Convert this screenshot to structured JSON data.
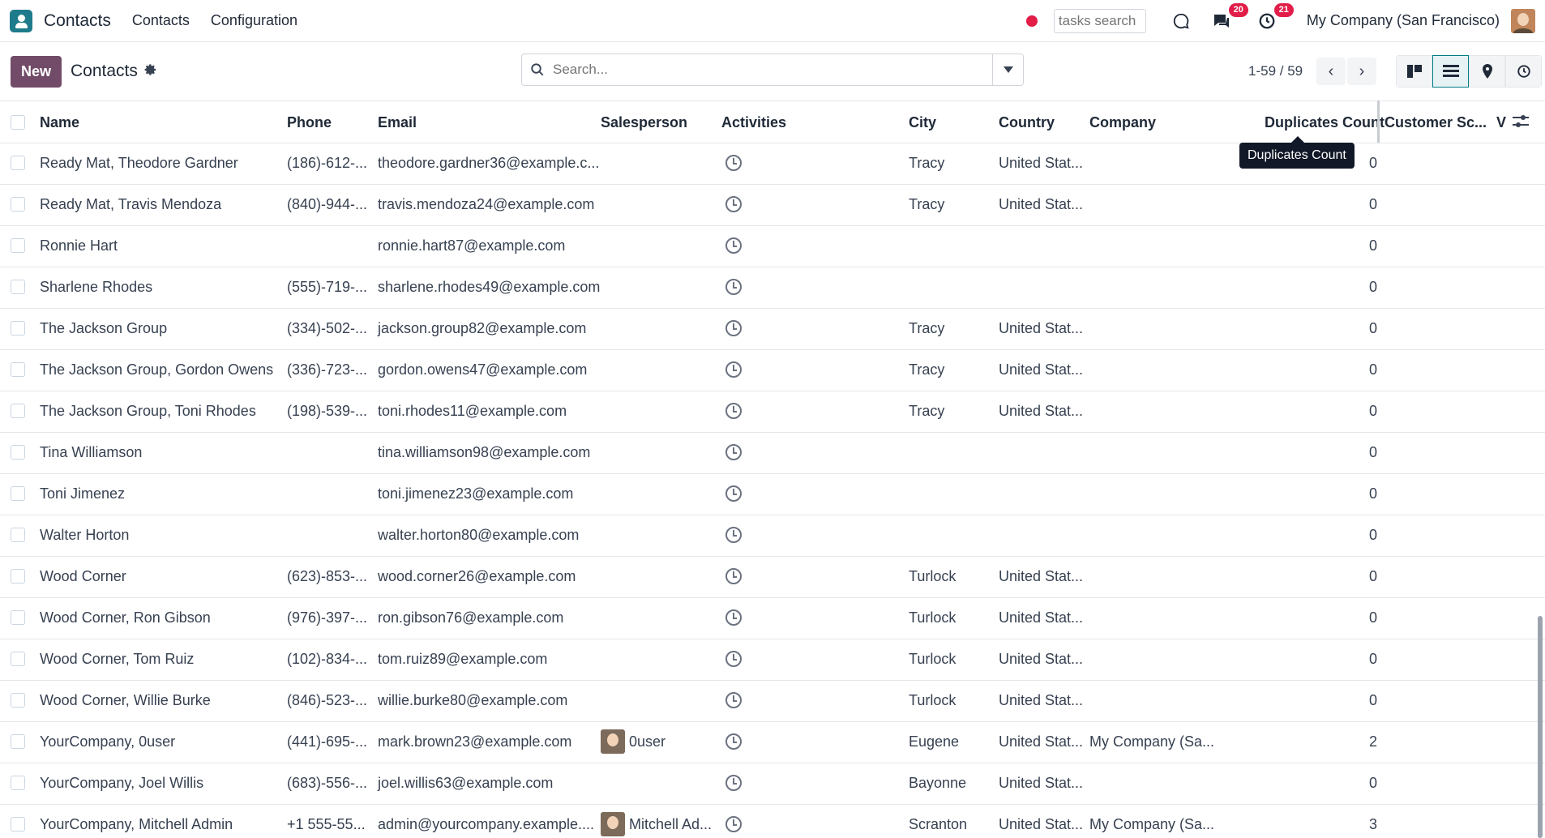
{
  "navbar": {
    "app_name": "Contacts",
    "menu": [
      "Contacts",
      "Configuration"
    ],
    "tasks_search_placeholder": "tasks search",
    "messages_badge": "20",
    "activities_badge": "21",
    "company": "My Company (San Francisco)"
  },
  "control": {
    "new_label": "New",
    "breadcrumb": "Contacts",
    "search_placeholder": "Search...",
    "pager": "1-59 / 59"
  },
  "columns": {
    "name": "Name",
    "phone": "Phone",
    "email": "Email",
    "salesperson": "Salesperson",
    "activities": "Activities",
    "city": "City",
    "country": "Country",
    "company": "Company",
    "duplicates": "Duplicates Count",
    "customer_score": "Customer Sc...",
    "more": "V"
  },
  "tooltip": "Duplicates Count",
  "rows": [
    {
      "name": "Ready Mat, Theodore Gardner",
      "phone": "(186)-612-...",
      "email": "theodore.gardner36@example.c...",
      "salesperson": "",
      "city": "Tracy",
      "country": "United Stat...",
      "company": "",
      "duplicates": "0"
    },
    {
      "name": "Ready Mat, Travis Mendoza",
      "phone": "(840)-944-...",
      "email": "travis.mendoza24@example.com",
      "salesperson": "",
      "city": "Tracy",
      "country": "United Stat...",
      "company": "",
      "duplicates": "0"
    },
    {
      "name": "Ronnie Hart",
      "phone": "",
      "email": "ronnie.hart87@example.com",
      "salesperson": "",
      "city": "",
      "country": "",
      "company": "",
      "duplicates": "0"
    },
    {
      "name": "Sharlene Rhodes",
      "phone": "(555)-719-...",
      "email": "sharlene.rhodes49@example.com",
      "salesperson": "",
      "city": "",
      "country": "",
      "company": "",
      "duplicates": "0"
    },
    {
      "name": "The Jackson Group",
      "phone": "(334)-502-...",
      "email": "jackson.group82@example.com",
      "salesperson": "",
      "city": "Tracy",
      "country": "United Stat...",
      "company": "",
      "duplicates": "0"
    },
    {
      "name": "The Jackson Group, Gordon Owens",
      "phone": "(336)-723-...",
      "email": "gordon.owens47@example.com",
      "salesperson": "",
      "city": "Tracy",
      "country": "United Stat...",
      "company": "",
      "duplicates": "0"
    },
    {
      "name": "The Jackson Group, Toni Rhodes",
      "phone": "(198)-539-...",
      "email": "toni.rhodes11@example.com",
      "salesperson": "",
      "city": "Tracy",
      "country": "United Stat...",
      "company": "",
      "duplicates": "0"
    },
    {
      "name": "Tina Williamson",
      "phone": "",
      "email": "tina.williamson98@example.com",
      "salesperson": "",
      "city": "",
      "country": "",
      "company": "",
      "duplicates": "0"
    },
    {
      "name": "Toni Jimenez",
      "phone": "",
      "email": "toni.jimenez23@example.com",
      "salesperson": "",
      "city": "",
      "country": "",
      "company": "",
      "duplicates": "0"
    },
    {
      "name": "Walter Horton",
      "phone": "",
      "email": "walter.horton80@example.com",
      "salesperson": "",
      "city": "",
      "country": "",
      "company": "",
      "duplicates": "0"
    },
    {
      "name": "Wood Corner",
      "phone": "(623)-853-...",
      "email": "wood.corner26@example.com",
      "salesperson": "",
      "city": "Turlock",
      "country": "United Stat...",
      "company": "",
      "duplicates": "0"
    },
    {
      "name": "Wood Corner, Ron Gibson",
      "phone": "(976)-397-...",
      "email": "ron.gibson76@example.com",
      "salesperson": "",
      "city": "Turlock",
      "country": "United Stat...",
      "company": "",
      "duplicates": "0"
    },
    {
      "name": "Wood Corner, Tom Ruiz",
      "phone": "(102)-834-...",
      "email": "tom.ruiz89@example.com",
      "salesperson": "",
      "city": "Turlock",
      "country": "United Stat...",
      "company": "",
      "duplicates": "0"
    },
    {
      "name": "Wood Corner, Willie Burke",
      "phone": "(846)-523-...",
      "email": "willie.burke80@example.com",
      "salesperson": "",
      "city": "Turlock",
      "country": "United Stat...",
      "company": "",
      "duplicates": "0"
    },
    {
      "name": "YourCompany, 0user",
      "phone": "(441)-695-...",
      "email": "mark.brown23@example.com",
      "salesperson": "0user",
      "city": "Eugene",
      "country": "United Stat...",
      "company": "My Company (Sa...",
      "duplicates": "2"
    },
    {
      "name": "YourCompany, Joel Willis",
      "phone": "(683)-556-...",
      "email": "joel.willis63@example.com",
      "salesperson": "",
      "city": "Bayonne",
      "country": "United Stat...",
      "company": "",
      "duplicates": "0"
    },
    {
      "name": "YourCompany, Mitchell Admin",
      "phone": "+1 555-55...",
      "email": "admin@yourcompany.example....",
      "salesperson": "Mitchell Ad...",
      "city": "Scranton",
      "country": "United Stat...",
      "company": "My Company (Sa...",
      "duplicates": "3"
    }
  ]
}
